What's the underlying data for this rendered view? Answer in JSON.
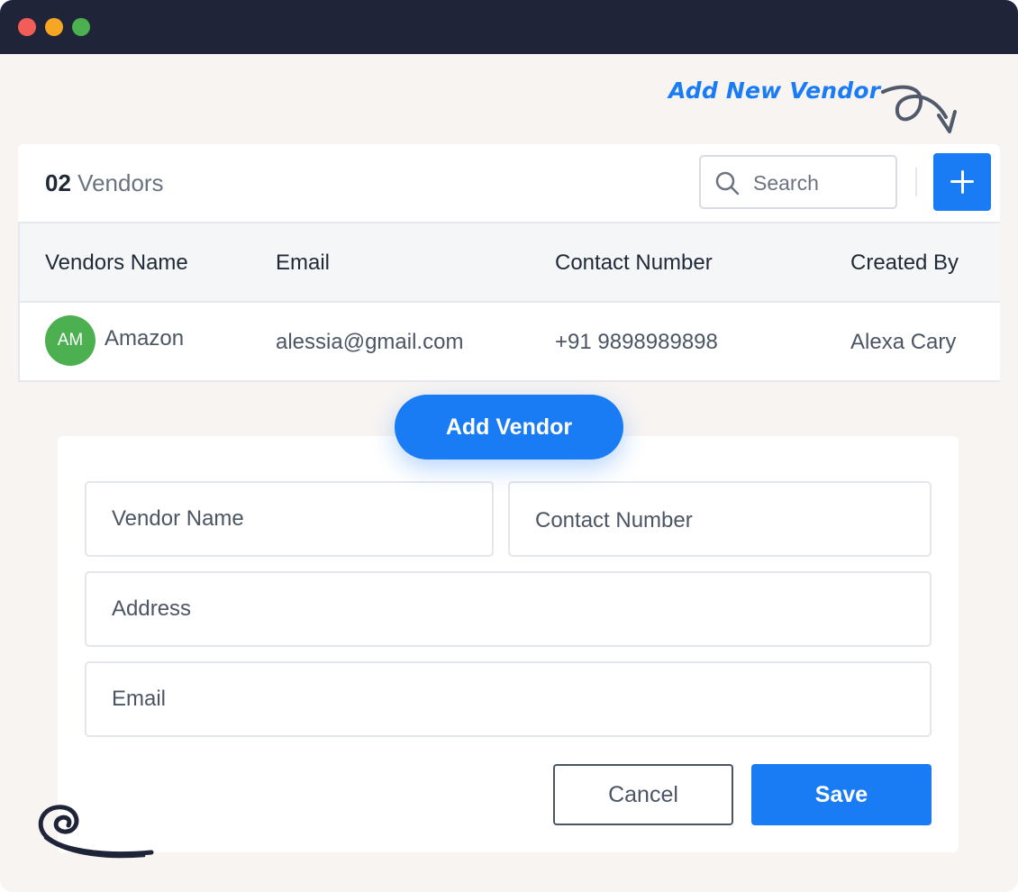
{
  "window": {
    "controls": [
      "close",
      "minimize",
      "maximize"
    ],
    "colors": {
      "titlebar": "#1f2438",
      "background": "#f7f4f2",
      "accent": "#1a7cf5"
    }
  },
  "callout": {
    "text": "Add New Vendor",
    "icon": "curly-arrow-icon"
  },
  "vendors": {
    "count": "02",
    "count_label": "Vendors",
    "search": {
      "placeholder": "Search",
      "icon": "search-icon"
    },
    "add_button_icon": "plus-icon",
    "table": {
      "columns": [
        "Vendors Name",
        "Email",
        "Contact Number",
        "Created By"
      ],
      "rows": [
        {
          "initials": "AM",
          "name": "Amazon",
          "email": "alessia@gmail.com",
          "contact": "+91 9898989898",
          "created_by": "Alexa Cary",
          "avatar_color": "#4cb050"
        }
      ]
    }
  },
  "form": {
    "title": "Add Vendor",
    "fields": {
      "vendor_name": "Vendor Name",
      "contact_number": "Contact Number",
      "address": "Address",
      "email": "Email"
    },
    "cancel_label": "Cancel",
    "save_label": "Save"
  },
  "decoration": {
    "icon": "spiral-scribble-icon"
  }
}
